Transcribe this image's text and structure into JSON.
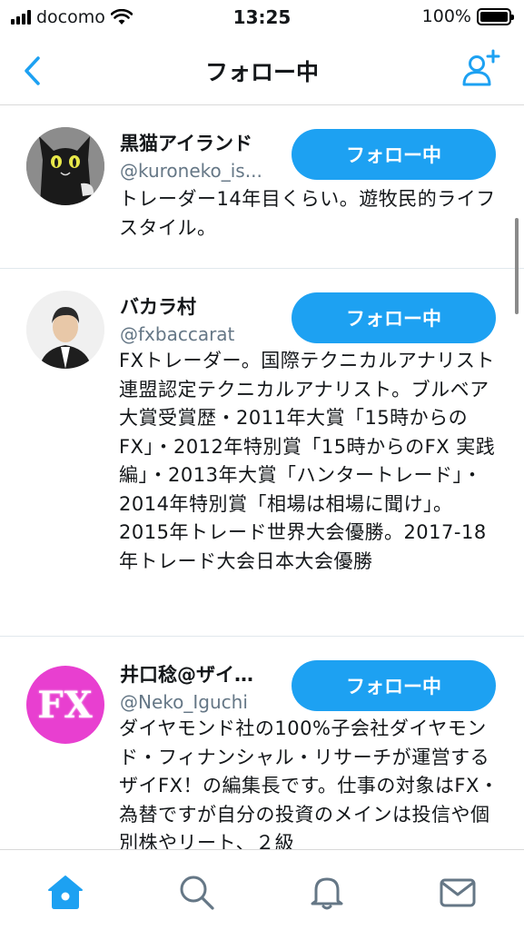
{
  "status": {
    "carrier": "docomo",
    "time": "13:25",
    "battery": "100%",
    "battery_level": 1.0
  },
  "nav": {
    "title": "フォロー中",
    "back_icon": "chevron-left-icon",
    "add_user_icon": "add-user-icon"
  },
  "users": [
    {
      "name": "黒猫アイランド",
      "handle": "@kuroneko_is...",
      "follow_label": "フォロー中",
      "bio": "トレーダー14年目くらい。遊牧民的ライフスタイル。"
    },
    {
      "name": "バカラ村",
      "handle": "@fxbaccarat",
      "follow_label": "フォロー中",
      "bio": "FXトレーダー。国際テクニカルアナリスト連盟認定テクニカルアナリスト。ブルベア大賞受賞歴・2011年大賞「15時からのFX」・2012年特別賞「15時からのFX 実践編」・2013年大賞「ハンタートレード」・2014年特別賞「相場は相場に聞け」。2015年トレード世界大会優勝。2017-18年トレード大会日本大会優勝"
    },
    {
      "name": "井口稔@ザイ…",
      "handle": "@Neko_Iguchi",
      "follow_label": "フォロー中",
      "avatar_text": "FX",
      "bio": "ダイヤモンド社の100%子会社ダイヤモンド・フィナンシャル・リサーチが運営するザイFX！の編集長です。仕事の対象はFX・為替ですが自分の投資のメインは投信や個別株やリート、２級"
    }
  ],
  "tabs": [
    {
      "icon": "home-icon",
      "active": true
    },
    {
      "icon": "search-icon",
      "active": false
    },
    {
      "icon": "bell-icon",
      "active": false
    },
    {
      "icon": "mail-icon",
      "active": false
    }
  ],
  "colors": {
    "accent": "#1da1f2",
    "text": "#14171a",
    "secondary": "#657786",
    "fx_pink": "#e83fd0"
  }
}
